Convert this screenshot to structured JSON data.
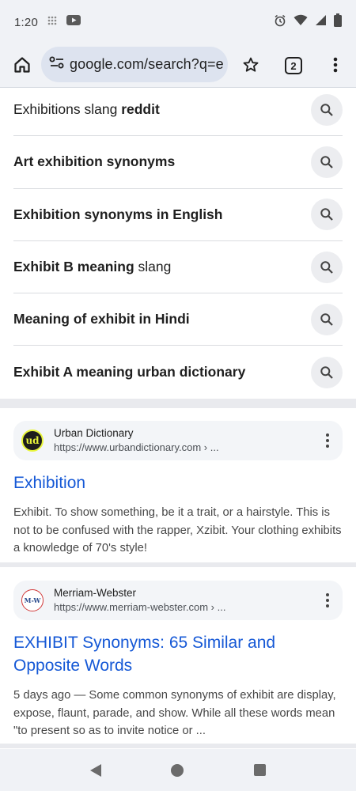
{
  "status_bar": {
    "time": "1:20",
    "left_icons": [
      "grid-dots-icon",
      "youtube-icon"
    ],
    "right_icons": [
      "alarm-icon",
      "wifi-icon",
      "signal-icon",
      "battery-icon"
    ]
  },
  "browser": {
    "url": "google.com/search?q=e",
    "tab_count": "2",
    "icons": [
      "home-icon",
      "site-settings-icon",
      "bookmark-star-icon",
      "tabs-icon",
      "more-menu-icon"
    ]
  },
  "related_searches": [
    {
      "pre": "Exhibitions slang ",
      "bold": "reddit",
      "post": ""
    },
    {
      "pre": "",
      "bold": "Art exhibition synonyms",
      "post": ""
    },
    {
      "pre": "",
      "bold": "Exhibition synonyms in English",
      "post": ""
    },
    {
      "pre": "",
      "bold": "Exhibit B meaning",
      "post": " slang"
    },
    {
      "pre": "",
      "bold": "Meaning of exhibit in Hindi",
      "post": ""
    },
    {
      "pre": "",
      "bold": "Exhibit A meaning urban dictionary",
      "post": ""
    }
  ],
  "results": [
    {
      "source_name": "Urban Dictionary",
      "source_url": "https://www.urbandictionary.com › ...",
      "favicon_text": "ud",
      "title": "Exhibition",
      "snippet": "Exhibit. To show something, be it a trait, or a hairstyle. This is not to be confused with the rapper, Xzibit. Your clothing exhibits a knowledge of 70's style!"
    },
    {
      "source_name": "Merriam-Webster",
      "source_url": "https://www.merriam-webster.com › ...",
      "favicon_text": "M-W",
      "title": "EXHIBIT Synonyms: 65 Similar and Opposite Words",
      "snippet": "5 days ago — Some common synonyms of exhibit are display, expose, flaunt, parade, and show. While all these words mean \"to present so as to invite notice or ..."
    }
  ],
  "colors": {
    "link": "#1558d6",
    "chrome_bg": "#f0f2f6",
    "omnibox_bg": "#dde3ef"
  },
  "navbar": {
    "icons": [
      "back-icon",
      "home-circle-icon",
      "recents-icon"
    ]
  }
}
